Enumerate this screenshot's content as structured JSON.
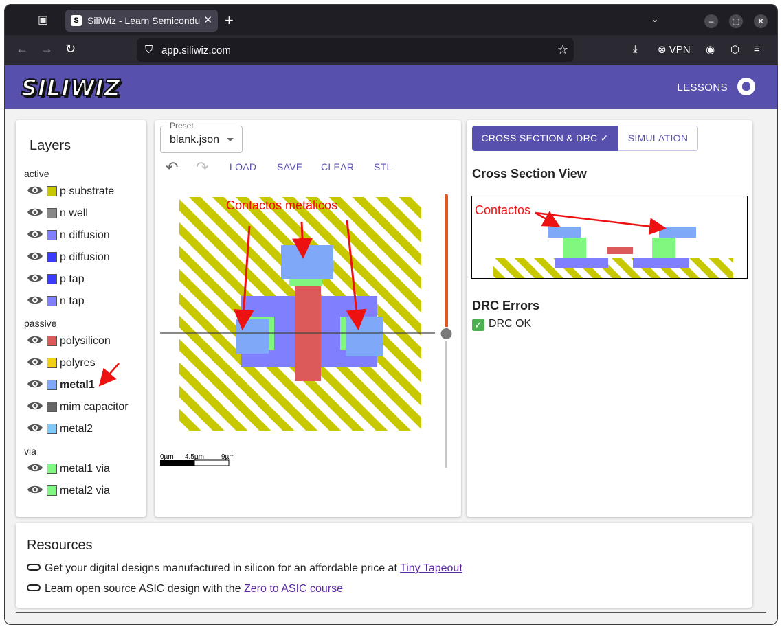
{
  "browser": {
    "tab_title": "SiliWiz - Learn Semicondu",
    "tab_favicon": "S",
    "url": "app.siliwiz.com",
    "vpn_label": "VPN",
    "window_controls": [
      "minimize",
      "maximize",
      "close"
    ]
  },
  "header": {
    "logo": "SILIWIZ",
    "lessons_label": "LESSONS",
    "github_icon": "github-icon"
  },
  "layers_panel": {
    "title": "Layers",
    "groups": [
      {
        "name": "active",
        "items": [
          {
            "label": "p substrate",
            "color": "#c8c800"
          },
          {
            "label": "n well",
            "color": "#888888"
          },
          {
            "label": "n diffusion",
            "color": "#8080ff"
          },
          {
            "label": "p diffusion",
            "color": "#3b3bff"
          },
          {
            "label": "p tap",
            "color": "#3b3bff"
          },
          {
            "label": "n tap",
            "color": "#8080ff"
          }
        ]
      },
      {
        "name": "passive",
        "items": [
          {
            "label": "polysilicon",
            "color": "#dc5a5a"
          },
          {
            "label": "polyres",
            "color": "#f0d010"
          },
          {
            "label": "metal1",
            "color": "#80a8f8",
            "selected": true
          },
          {
            "label": "mim capacitor",
            "color": "#666666"
          },
          {
            "label": "metal2",
            "color": "#80c8f8"
          }
        ]
      },
      {
        "name": "via",
        "items": [
          {
            "label": "metal1 via",
            "color": "#80f880"
          },
          {
            "label": "metal2 via",
            "color": "#80f880"
          }
        ]
      }
    ]
  },
  "editor": {
    "preset_label": "Preset",
    "preset_value": "blank.json",
    "toolbar": {
      "load": "LOAD",
      "save": "SAVE",
      "clear": "CLEAR",
      "stl": "STL"
    },
    "annotation": "Contactos metálicos",
    "scale_labels": [
      "0µm",
      "4.5µm",
      "9µm"
    ]
  },
  "side_panel": {
    "tab_cross_section": "CROSS SECTION & DRC",
    "tab_simulation": "SIMULATION",
    "cross_section_title": "Cross Section View",
    "cross_section_annotation": "Contactos",
    "drc_title": "DRC Errors",
    "drc_status": "DRC OK"
  },
  "resources": {
    "title": "Resources",
    "line1_text": "Get your digital designs manufactured in silicon for an affordable price at ",
    "line1_link": "Tiny Tapeout",
    "line2_text": "Learn open source ASIC design with the ",
    "line2_link": "Zero to ASIC course"
  }
}
